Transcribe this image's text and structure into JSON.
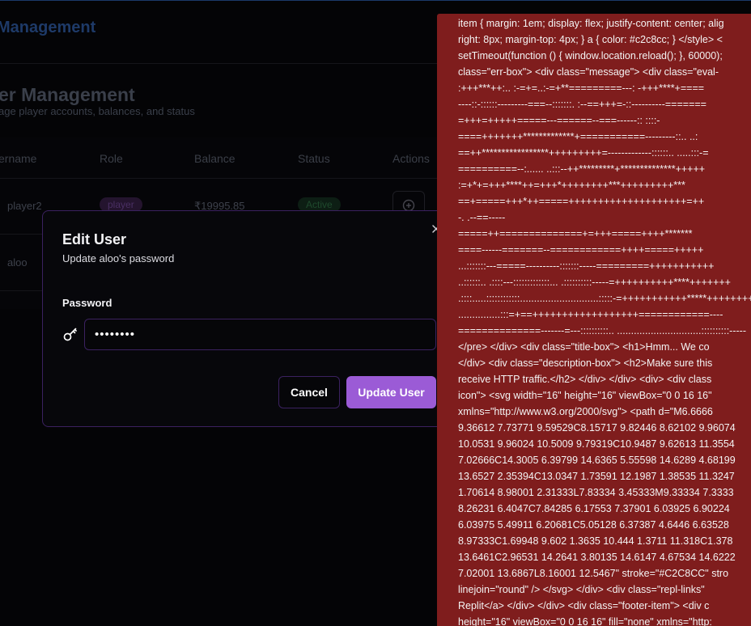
{
  "app": {
    "title": "Management"
  },
  "page": {
    "title": "er Management",
    "subtitle": "age player accounts, balances, and status"
  },
  "table": {
    "headers": [
      "ername",
      "Role",
      "Balance",
      "Status",
      "Actions"
    ],
    "rows": [
      {
        "username": "player2",
        "role": "player",
        "balance": "₹19995.85",
        "status": "Active"
      },
      {
        "username": "aloo"
      }
    ]
  },
  "icons": {
    "action": "plus-circle-icon",
    "close": "close-icon",
    "password": "key-icon"
  },
  "modal": {
    "title": "Edit User",
    "description": "Update aloo's password",
    "password_label": "Password",
    "password_value": "••••••••",
    "cancel_label": "Cancel",
    "submit_label": "Update User"
  },
  "colors": {
    "accent": "#9b5bd6",
    "error_bg": "#7f1d1d",
    "modal_border": "#3b2160"
  },
  "error_overlay": {
    "lines": [
      "item { margin: 1em; display: flex; justify-content: center; alig",
      "right: 8px; margin-top: 4px; } a { color: #c2c8cc; } </style> <",
      "setTimeout(function () { window.location.reload(); }, 60000);",
      "class=\"err-box\"> <div class=\"message\"> <div class=\"eval-",
      ":+++***++:.. :-=+=..:-=+**=========---: -+++****+====",
      "----::-::::::---------===--:::::::. :--==+++=-::----------=======",
      "=+++=+++++=====---======--===------:: ::::-",
      "====+++++++*************+===========---------::.. ..:",
      "==++*****************+++++++++=-------------::::::.. .....:::-=",
      "==========--:...... ..:::--++*********+**************+++++",
      ":=+*+=+++****++=+++*++++++++***+++++++++***",
      "==+=====+++*++=====++++++++++++++++++++=++",
      "-. .--==-----",
      "=====++==============+=+++=====++++*******",
      "====------=======--============++++=====+++++",
      "...:::::::---=====----------:::::::-----=========+++++++++++",
      "..::::::.. .::::---:::::::::::::... .::::::::::-----=++++++++++****+++++++",
      ".::::.....::::::::::::............................:::::-=+++++++++++*****++++++++=",
      "...............:::=+==++++++++++++++++++============----",
      "==============-------=---::::::::::.. ..............................::::::::::-----",
      "</pre> </div> <div class=\"title-box\"> <h1>Hmm... We co",
      "</div> <div class=\"description-box\"> <h2>Make sure this",
      "receive HTTP traffic.</h2> </div> </div> <div> <div class",
      "icon\"> <svg width=\"16\" height=\"16\" viewBox=\"0 0 16 16\"",
      "xmlns=\"http://www.w3.org/2000/svg\"> <path d=\"M6.6666",
      "9.36612 7.73771 9.59529C8.15717 9.82446 8.62102 9.96074",
      "10.0531 9.96024 10.5009 9.79319C10.9487 9.62613 11.3554",
      "7.02666C14.3005 6.39799 14.6365 5.55598 14.6289 4.68199",
      "13.6527 2.35394C13.0347 1.73591 12.1987 1.38535 11.3247",
      "1.70614 8.98001 2.31333L7.83334 3.45333M9.33334 7.3333",
      "8.26231 6.4047C7.84285 6.17553 7.37901 6.03925 6.90224",
      "6.03975 5.49911 6.20681C5.05128 6.37387 4.6446 6.63528",
      "8.97333C1.69948 9.602 1.3635 10.444 1.3711 11.318C1.378",
      "13.6461C2.96531 14.2641 3.80135 14.6147 4.67534 14.6222",
      "7.02001 13.6867L8.16001 12.5467\" stroke=\"#C2C8CC\" stro",
      "linejoin=\"round\" /> </svg> </div> <div class=\"repl-links\"",
      "Replit</a> </div> </div> <div class=\"footer-item\"> <div c",
      "height=\"16\" viewBox=\"0 0 16 16\" fill=\"none\" xmlns=\"http:"
    ]
  }
}
